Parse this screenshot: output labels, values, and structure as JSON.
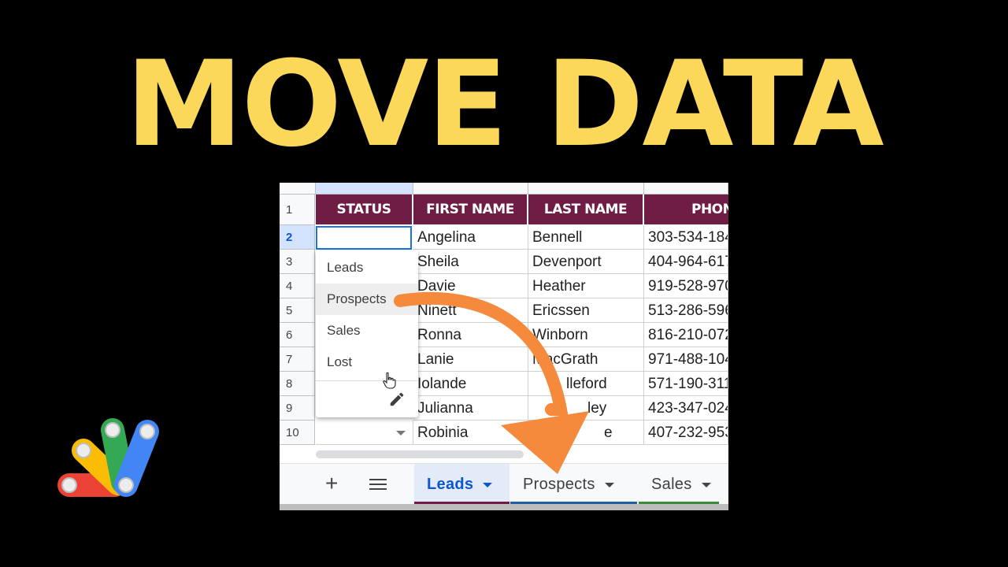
{
  "headline": "MOVE DATA",
  "sheet": {
    "selected_row": "2",
    "headers": [
      "STATUS",
      "FIRST NAME",
      "LAST NAME",
      "PHONE"
    ],
    "header_color": "#6f1d45",
    "row_numbers": [
      "1",
      "2",
      "3",
      "4",
      "5",
      "6",
      "7",
      "8",
      "9",
      "10"
    ],
    "rows": [
      {
        "first": "Angelina",
        "last": "Bennell",
        "phone": "303-534-184"
      },
      {
        "first": "Sheila",
        "last": "Devenport",
        "phone": "404-964-617"
      },
      {
        "first": "Davie",
        "last": "Heather",
        "phone": "919-528-970"
      },
      {
        "first": "Ninett",
        "last": "Ericssen",
        "phone": "513-286-596"
      },
      {
        "first": "Ronna",
        "last": "Winborn",
        "phone": "816-210-072"
      },
      {
        "first": "Lanie",
        "last": "MacGrath",
        "phone": "971-488-104"
      },
      {
        "first": "Iolande",
        "last": "lleford",
        "phone": "571-190-311"
      },
      {
        "first": "Julianna",
        "last": "ley",
        "phone": "423-347-024"
      },
      {
        "first": "Robinia",
        "last": "e",
        "phone": "407-232-953"
      }
    ],
    "dropdown_options": [
      "Leads",
      "Prospects",
      "Sales",
      "Lost"
    ],
    "dropdown_hovered": "Prospects",
    "tabs": [
      {
        "label": "Leads",
        "color": "#6f1d45",
        "active": true
      },
      {
        "label": "Prospects",
        "color": "#1f5fa8",
        "active": false
      },
      {
        "label": "Sales",
        "color": "#3a8a3a",
        "active": false
      }
    ]
  },
  "colors": {
    "headline": "#FCD85A",
    "arrow": "#F58A3C",
    "selection": "#1a73e8"
  },
  "icons": [
    "plus-icon",
    "all-sheets-menu-icon",
    "pencil-icon",
    "hand-cursor-icon",
    "apps-script-logo-icon"
  ]
}
